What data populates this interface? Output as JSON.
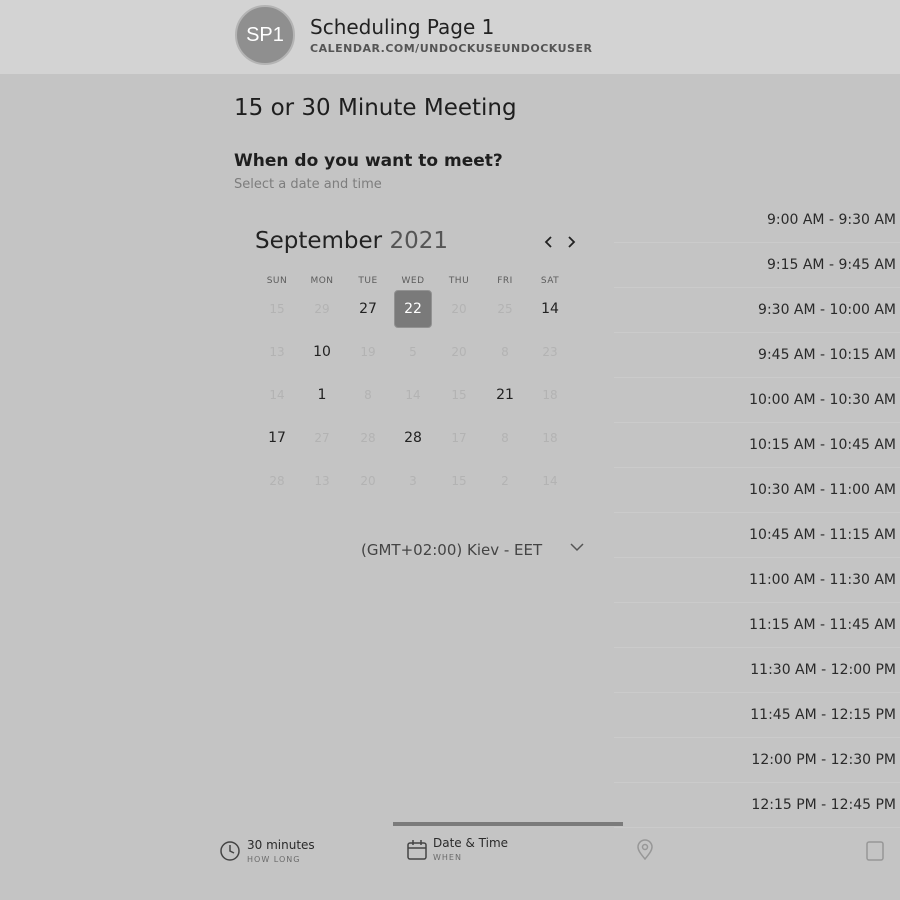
{
  "header": {
    "avatar_initials": "SP1",
    "page_name": "Scheduling Page 1",
    "page_url": "CALENDAR.COM/UNDOCKUSEUNDOCKUSER"
  },
  "meeting": {
    "title": "15 or 30 Minute Meeting",
    "question": "When do you want to meet?",
    "hint": "Select a date and time"
  },
  "calendar": {
    "month": "September",
    "year": "2021",
    "prev_icon": "chevron-left-icon",
    "next_icon": "chevron-right-icon",
    "weekdays": [
      "SUN",
      "MON",
      "TUE",
      "WED",
      "THU",
      "FRI",
      "SAT"
    ],
    "weeks": [
      [
        "15",
        "29",
        "27",
        "22",
        "20",
        "25",
        "14"
      ],
      [
        "13",
        "10",
        "19",
        "5",
        "20",
        "8",
        "23"
      ],
      [
        "14",
        "1",
        "8",
        "14",
        "15",
        "21",
        "18"
      ],
      [
        "17",
        "27",
        "28",
        "28",
        "17",
        "8",
        "18"
      ],
      [
        "28",
        "13",
        "20",
        "3",
        "15",
        "2",
        "14"
      ]
    ],
    "available_days": [
      [
        0,
        2
      ],
      [
        0,
        6
      ],
      [
        1,
        1
      ],
      [
        2,
        1
      ],
      [
        2,
        5
      ],
      [
        3,
        0
      ],
      [
        3,
        3
      ]
    ],
    "selected_day": [
      0,
      3
    ]
  },
  "timezone": {
    "value": "(GMT+02:00) Kiev - EET",
    "chevron_icon": "chevron-down-icon"
  },
  "slots": [
    "9:00 AM - 9:30 AM",
    "9:15 AM - 9:45 AM",
    "9:30 AM - 10:00 AM",
    "9:45 AM - 10:15 AM",
    "10:00 AM - 10:30 AM",
    "10:15 AM - 10:45 AM",
    "10:30 AM - 11:00 AM",
    "10:45 AM - 11:15 AM",
    "11:00 AM - 11:30 AM",
    "11:15 AM - 11:45 AM",
    "11:30 AM - 12:00 PM",
    "11:45 AM - 12:15 PM",
    "12:00 PM - 12:30 PM",
    "12:15 PM - 12:45 PM"
  ],
  "steps": {
    "progress_fraction": 1.0,
    "duration": {
      "label": "30 minutes",
      "sub": "HOW LONG",
      "icon": "clock-icon"
    },
    "datetime": {
      "label": "Date & Time",
      "sub": "WHEN",
      "icon": "calendar-icon"
    },
    "location": {
      "icon": "location-pin-icon"
    },
    "details": {
      "icon": "document-icon"
    }
  },
  "colors": {
    "background": "#c4c4c4",
    "header_bg": "#d3d3d3",
    "selected_day": "#7a7a7a",
    "avatar": "#8f8f8f"
  }
}
